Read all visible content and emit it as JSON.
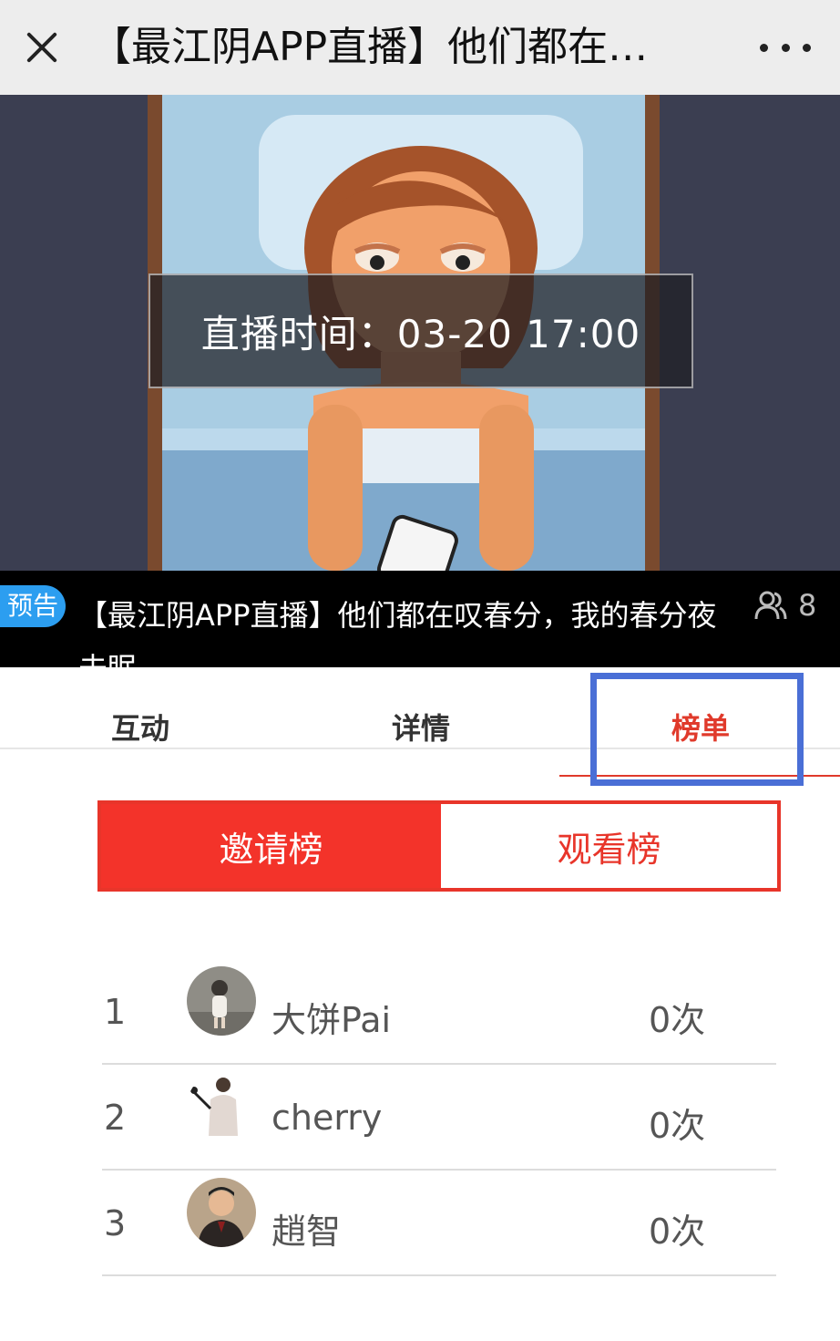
{
  "topbar": {
    "title": "【最江阴APP直播】他们都在…",
    "close_icon": "close-icon",
    "more_icon": "more-icon"
  },
  "cover": {
    "live_time": "直播时间：03-20 17:00"
  },
  "info": {
    "badge": "预告",
    "title": "【最江阴APP直播】他们都在叹春分，我的春分夜未眠……",
    "viewer_count": "8",
    "viewer_icon": "people-icon"
  },
  "tabs": [
    {
      "label": "互动",
      "active": false
    },
    {
      "label": "详情",
      "active": false
    },
    {
      "label": "榜单",
      "active": true
    }
  ],
  "segment": {
    "invite_label": "邀请榜",
    "watch_label": "观看榜"
  },
  "ranking": [
    {
      "rank": "1",
      "name": "大饼Pai",
      "count": "0次"
    },
    {
      "rank": "2",
      "name": "cherry",
      "count": "0次"
    },
    {
      "rank": "3",
      "name": "趙智",
      "count": "0次"
    }
  ],
  "colors": {
    "accent_red": "#e8352a",
    "badge_blue": "#2c9ef0",
    "highlight_blue": "#4a6fd6"
  }
}
